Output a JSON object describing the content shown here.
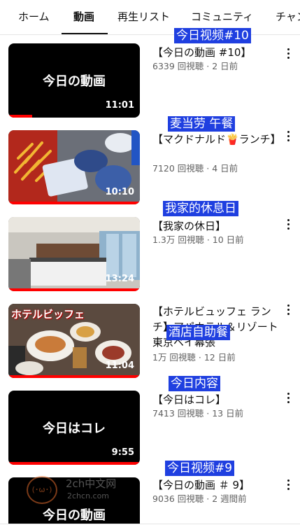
{
  "tabs": [
    {
      "label": "ホーム"
    },
    {
      "label": "動画",
      "active": true
    },
    {
      "label": "再生リスト"
    },
    {
      "label": "コミュニティ"
    },
    {
      "label": "チャン"
    }
  ],
  "videos": [
    {
      "title": "【今日の動画 #10】",
      "meta": "6339 回視聴 · 2 日前",
      "duration": "11:01",
      "thumb_text": "今日の動画",
      "annotation": "今日视频#10",
      "progress": 0.18
    },
    {
      "title": "【マクドナルド🍟ランチ】",
      "meta": "7120 回視聴 · 4 日前",
      "duration": "10:10",
      "annotation": "麦当劳 午餐",
      "progress": 1.0
    },
    {
      "title": "【我家の休日】",
      "meta": "1.3万 回視聴 · 10 日前",
      "duration": "13:24",
      "annotation": "我家的休息日",
      "progress": 1.0
    },
    {
      "title": "【ホテルビュッフェ ランチ】アパホテル＆リゾート 東京ベイ幕張",
      "meta": "1万 回視聴 · 12 日前",
      "duration": "11:04",
      "thumb_text": "ホテルビッフェ",
      "annotation": "酒店自助餐",
      "progress": 1.0
    },
    {
      "title": "【今日はコレ】",
      "meta": "7413 回視聴 · 13 日前",
      "duration": "9:55",
      "thumb_text": "今日はコレ",
      "annotation": "今日内容",
      "progress": 1.0
    },
    {
      "title": "【今日の動画 ＃ 9】",
      "meta": "9036 回視聴 · 2 週間前",
      "thumb_text": "今日の動画",
      "annotation": "今日视频#9",
      "progress": 0
    }
  ],
  "watermark": {
    "site": "2ch中文网",
    "url": "2chcn.com",
    "face": "(･ω･)"
  },
  "colors": {
    "progress": "#ff0000",
    "annotation": "#1f3fe0",
    "meta": "#606060"
  }
}
